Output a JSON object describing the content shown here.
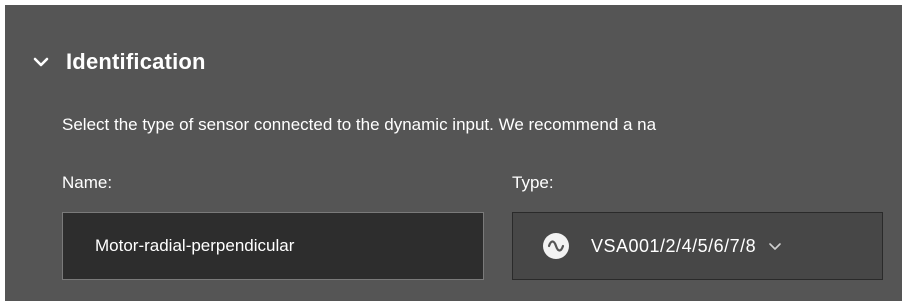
{
  "section": {
    "title": "Identification",
    "expanded_icon": "chevron-down-icon"
  },
  "description": "Select the type of sensor connected to the dynamic input. We recommend a na",
  "name_field": {
    "label": "Name:",
    "value": "Motor-radial-perpendicular"
  },
  "type_field": {
    "label": "Type:",
    "icon": "sine-wave-icon",
    "value": "VSA001/2/4/5/6/7/8",
    "dropdown_icon": "chevron-down-icon"
  },
  "colors": {
    "panel_background": "#555555",
    "input_background": "#2d2d2d",
    "select_background": "#474747",
    "text": "#ffffff"
  }
}
